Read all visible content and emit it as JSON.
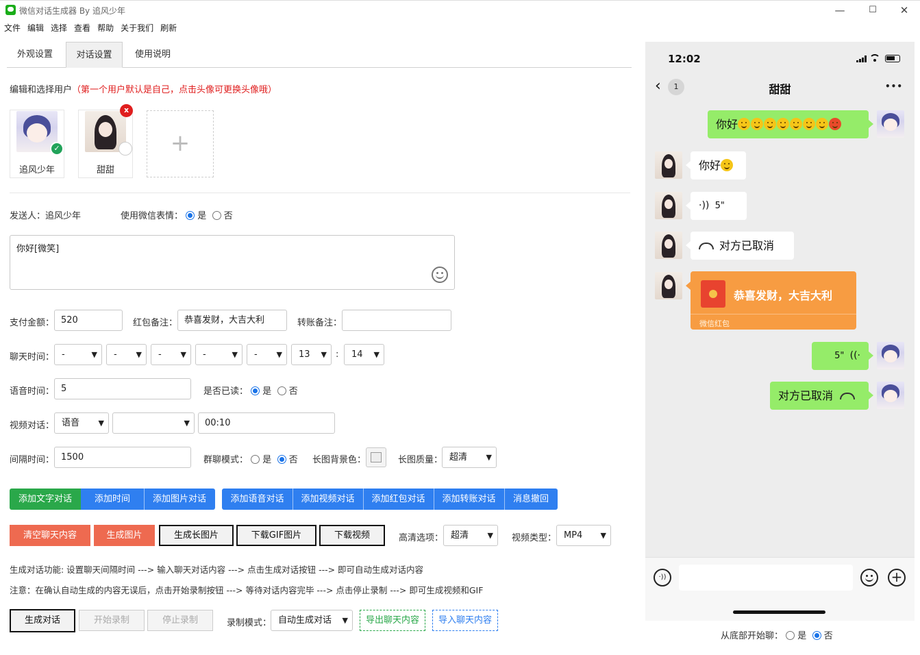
{
  "window": {
    "title": "微信对话生成器 By 追风少年",
    "minimize": "—",
    "maximize": "☐",
    "close": "✕"
  },
  "menu": [
    "文件",
    "编辑",
    "选择",
    "查看",
    "帮助",
    "关于我们",
    "刷新"
  ],
  "tabs": [
    {
      "label": "外观设置",
      "active": false
    },
    {
      "label": "对话设置",
      "active": true
    },
    {
      "label": "使用说明",
      "active": false
    }
  ],
  "users_section": {
    "title": "编辑和选择用户",
    "hint": "（第一个用户默认是自己，点击头像可更换头像哦）",
    "users": [
      {
        "name": "追风少年",
        "selected": true
      },
      {
        "name": "甜甜",
        "selected": false,
        "delete_label": "x"
      }
    ],
    "add_label": "+"
  },
  "sender": {
    "label": "发送人：",
    "value": "追风少年"
  },
  "wechat_emoji": {
    "label": "使用微信表情：",
    "yes": "是",
    "no": "否",
    "value": "是"
  },
  "message_text": "你好[微笑]",
  "payment": {
    "amount_label": "支付金额：",
    "amount": "520",
    "redpacket_label": "红包备注：",
    "redpacket": "恭喜发财，大吉大利",
    "transfer_label": "转账备注：",
    "transfer": ""
  },
  "chat_time": {
    "label": "聊天时间：",
    "fields": [
      "-",
      "-",
      "-",
      "-",
      "-"
    ],
    "hour": "13",
    "minute": "14",
    "colon": ":"
  },
  "voice": {
    "label": "语音时间：",
    "value": "5",
    "read_label": "是否已读：",
    "yes": "是",
    "no": "否",
    "read": "是"
  },
  "video": {
    "label": "视频对话：",
    "type": "语音",
    "status": "",
    "duration": "00:10"
  },
  "interval": {
    "label": "间隔时间：",
    "value": "1500",
    "group_label": "群聊模式：",
    "yes": "是",
    "no": "否",
    "group": "否",
    "bg_label": "长图背景色：",
    "quality_label": "长图质量：",
    "quality": "超清"
  },
  "add_buttons": [
    "添加文字对话",
    "添加时间",
    "添加图片对话",
    "添加语音对话",
    "添加视频对话",
    "添加红包对话",
    "添加转账对话",
    "消息撤回"
  ],
  "action_buttons": {
    "clear": "清空聊天内容",
    "gen_image": "生成图片",
    "gen_long": "生成长图片",
    "download_gif": "下载GIF图片",
    "download_video": "下载视频",
    "hd_label": "高清选项：",
    "hd": "超清",
    "video_type_label": "视频类型：",
    "video_type": "MP4"
  },
  "notes": {
    "line1": "生成对话功能: 设置聊天间隔时间 ---> 输入聊天对话内容 ---> 点击生成对话按钮 ---> 即可自动生成对话内容",
    "line2": "注意：在确认自动生成的内容无误后，点击开始录制按钮 ---> 等待对话内容完毕 ---> 点击停止录制 ---> 即可生成视频和GIF"
  },
  "record": {
    "generate": "生成对话",
    "start": "开始录制",
    "stop": "停止录制",
    "mode_label": "录制模式：",
    "mode": "自动生成对话",
    "export": "导出聊天内容",
    "import": "导入聊天内容"
  },
  "phone": {
    "time": "12:02",
    "back_badge": "1",
    "chat_title": "甜甜",
    "more": "•••",
    "messages": [
      {
        "side": "right",
        "type": "text",
        "text": "你好"
      },
      {
        "side": "left",
        "type": "text",
        "text": "你好"
      },
      {
        "side": "left",
        "type": "voice",
        "text": "5\""
      },
      {
        "side": "left",
        "type": "call",
        "text": "对方已取消"
      },
      {
        "side": "left",
        "type": "redpacket",
        "text": "恭喜发财，大吉大利",
        "footer": "微信红包"
      },
      {
        "side": "right",
        "type": "voice",
        "text": "5\""
      },
      {
        "side": "right",
        "type": "call",
        "text": "对方已取消"
      }
    ]
  },
  "from_bottom": {
    "label": "从底部开始聊：",
    "yes": "是",
    "no": "否",
    "value": "否"
  },
  "colors": {
    "wechat_green": "#95ec69",
    "redpacket": "#f79c42",
    "button_blue": "#2f7ff0",
    "button_green": "#2aa84a",
    "button_red": "#ee6a50"
  }
}
